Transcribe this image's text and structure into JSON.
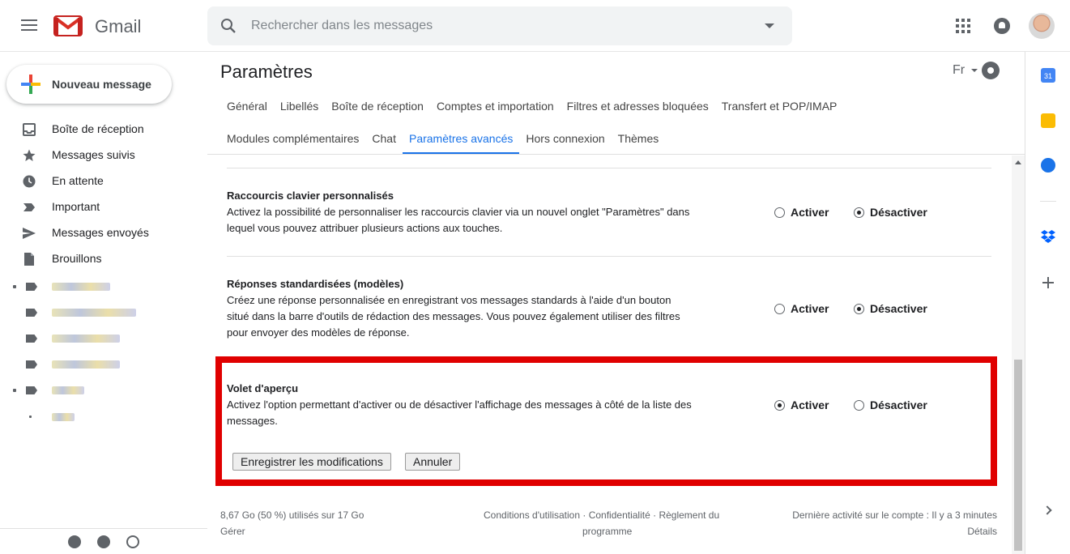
{
  "app": {
    "name": "Gmail"
  },
  "search": {
    "placeholder": "Rechercher dans les messages"
  },
  "compose": {
    "label": "Nouveau message"
  },
  "sidebar": {
    "items": [
      {
        "label": "Boîte de réception",
        "icon": "inbox-icon"
      },
      {
        "label": "Messages suivis",
        "icon": "star-icon"
      },
      {
        "label": "En attente",
        "icon": "clock-icon"
      },
      {
        "label": "Important",
        "icon": "important-icon"
      },
      {
        "label": "Messages envoyés",
        "icon": "send-icon"
      },
      {
        "label": "Brouillons",
        "icon": "draft-icon"
      }
    ],
    "bottom_icons": [
      "contacts-icon",
      "hangouts-icon",
      "phone-icon"
    ]
  },
  "settings": {
    "title": "Paramètres",
    "language": "Fr",
    "tabs_row1": [
      "Général",
      "Libellés",
      "Boîte de réception",
      "Comptes et importation",
      "Filtres et adresses bloquées",
      "Transfert et POP/IMAP"
    ],
    "tabs_row2": [
      "Modules complémentaires",
      "Chat",
      "Paramètres avancés",
      "Hors connexion",
      "Thèmes"
    ],
    "active_tab": "Paramètres avancés",
    "options": [
      {
        "title": "Raccourcis clavier personnalisés",
        "desc": "Activez la possibilité de personnaliser les raccourcis clavier via un nouvel onglet \"Paramètres\" dans lequel vous pouvez attribuer plusieurs actions aux touches.",
        "enable_label": "Activer",
        "disable_label": "Désactiver",
        "selected": "Désactiver"
      },
      {
        "title": "Réponses standardisées (modèles)",
        "desc": "Créez une réponse personnalisée en enregistrant vos messages standards à l'aide d'un bouton situé dans la barre d'outils de rédaction des messages. Vous pouvez également utiliser des filtres pour envoyer des modèles de réponse.",
        "enable_label": "Activer",
        "disable_label": "Désactiver",
        "selected": "Désactiver"
      },
      {
        "title": "Volet d'aperçu",
        "desc": "Activez l'option permettant d'activer ou de désactiver l'affichage des messages à côté de la liste des messages.",
        "enable_label": "Activer",
        "disable_label": "Désactiver",
        "selected": "Activer"
      }
    ],
    "save_label": "Enregistrer les modifications",
    "cancel_label": "Annuler"
  },
  "footer": {
    "storage": "8,67 Go (50 %) utilisés sur 17 Go",
    "manage": "Gérer",
    "terms": "Conditions d'utilisation",
    "privacy": "Confidentialité",
    "policy_line1": "Règlement du",
    "policy_line2": "programme",
    "separator": " · ",
    "last_activity": "Dernière activité sur le compte : Il y a 3 minutes",
    "details": "Détails"
  },
  "right_rail": {
    "calendar_day": "31",
    "icons": [
      "calendar-icon",
      "keep-icon",
      "tasks-icon",
      "dropbox-icon",
      "add-addon-icon"
    ]
  },
  "colors": {
    "accent": "#1a73e8",
    "highlight": "#e00000"
  }
}
